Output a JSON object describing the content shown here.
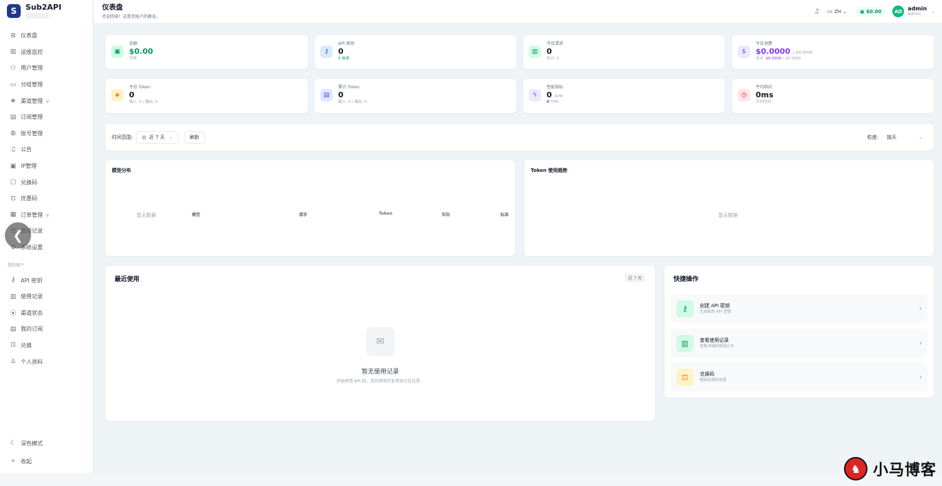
{
  "app": {
    "name": "Sub2API"
  },
  "sidebar": {
    "items": [
      {
        "label": "仪表盘",
        "icon": "grid-icon"
      },
      {
        "label": "运维监控",
        "icon": "bar-chart-icon"
      },
      {
        "label": "用户管理",
        "icon": "users-icon"
      },
      {
        "label": "分组管理",
        "icon": "folder-icon"
      },
      {
        "label": "渠道管理",
        "icon": "layers-icon",
        "chevron": "∨"
      },
      {
        "label": "订阅管理",
        "icon": "card-icon"
      },
      {
        "label": "账号管理",
        "icon": "globe-icon"
      },
      {
        "label": "公告",
        "icon": "bell-icon"
      },
      {
        "label": "IP管理",
        "icon": "clipboard-icon"
      },
      {
        "label": "兑换码",
        "icon": "ticket-icon"
      },
      {
        "label": "优惠码",
        "icon": "gift-icon"
      },
      {
        "label": "订单管理",
        "icon": "receipt-icon",
        "chevron": "∨"
      },
      {
        "label": "使用记录",
        "icon": "list-icon"
      },
      {
        "label": "系统设置",
        "icon": "settings-icon"
      }
    ],
    "section_label": "我的账户",
    "account_items": [
      {
        "label": "API 密钥",
        "icon": "key-icon"
      },
      {
        "label": "使用记录",
        "icon": "bar-chart-icon"
      },
      {
        "label": "渠道状态",
        "icon": "signal-icon"
      },
      {
        "label": "我的订阅",
        "icon": "card-icon"
      },
      {
        "label": "兑换",
        "icon": "gift-icon"
      },
      {
        "label": "个人资料",
        "icon": "user-icon"
      }
    ],
    "dark_mode": "深色模式",
    "collapse": "收起"
  },
  "header": {
    "title": "仪表盘",
    "subtitle": "欢迎回来！这是您账户的概览。",
    "lang_prefix": "CN",
    "lang": "ZH",
    "balance": "$0.00",
    "avatar_initials": "AD",
    "username": "admin",
    "role": "Admin"
  },
  "stats": {
    "balance": {
      "label": "余额",
      "value": "$0.00",
      "foot": "可用"
    },
    "api_keys": {
      "label": "API 密钥",
      "value": "0",
      "foot": "0 启用"
    },
    "today_requests": {
      "label": "今日请求",
      "value": "0",
      "foot": "总计: 0"
    },
    "today_cost": {
      "label": "今日消费",
      "value": "$0.0000",
      "secondary": "/ $0.0000",
      "foot_prefix": "总计: ",
      "foot_value": "$0.0000",
      "foot_suffix": " / $0.0000"
    },
    "today_token": {
      "label": "今日 Token",
      "value": "0",
      "foot": "输入: 0 / 输出: 0"
    },
    "total_token": {
      "label": "累计 Token",
      "value": "0",
      "foot": "输入: 0 / 输出: 0"
    },
    "performance": {
      "label": "性能指标",
      "value": "0",
      "unit": "RPM",
      "sub_value": "0",
      "sub_unit": "TPM"
    },
    "avg_response": {
      "label": "平均响应",
      "value": "0ms",
      "foot": "平均时间"
    }
  },
  "filter": {
    "range_label": "时间范围:",
    "range_value": "近 7 天",
    "refresh": "刷新",
    "granularity_label": "粒度:",
    "granularity_value": "按天"
  },
  "model_panel": {
    "title": "模型分布",
    "no_data": "暂无数据",
    "columns": [
      "模型",
      "请求",
      "Token",
      "实际",
      "标准"
    ]
  },
  "token_panel": {
    "title": "Token 使用趋势",
    "no_data": "暂无数据"
  },
  "recent": {
    "title": "最近使用",
    "tag": "近 7 天",
    "empty_title": "暂无使用记录",
    "empty_sub": "开始使用 API 后，您的使用历史将显示在这里。"
  },
  "quick": {
    "title": "快捷操作",
    "items": [
      {
        "title": "创建 API 密钥",
        "sub": "生成新的 API 密钥",
        "icon": "key-icon"
      },
      {
        "title": "查看使用记录",
        "sub": "查看详细的使用日志",
        "icon": "bar-chart-icon"
      },
      {
        "title": "兑换码",
        "sub": "使用兑换码充值",
        "icon": "gift-icon"
      }
    ]
  },
  "watermark": {
    "text": "小马博客"
  },
  "colors": {
    "accent": "#10b981",
    "purple": "#7c3aed",
    "sidebar_bg": "#ffffff",
    "page_bg": "#eef3f5"
  }
}
